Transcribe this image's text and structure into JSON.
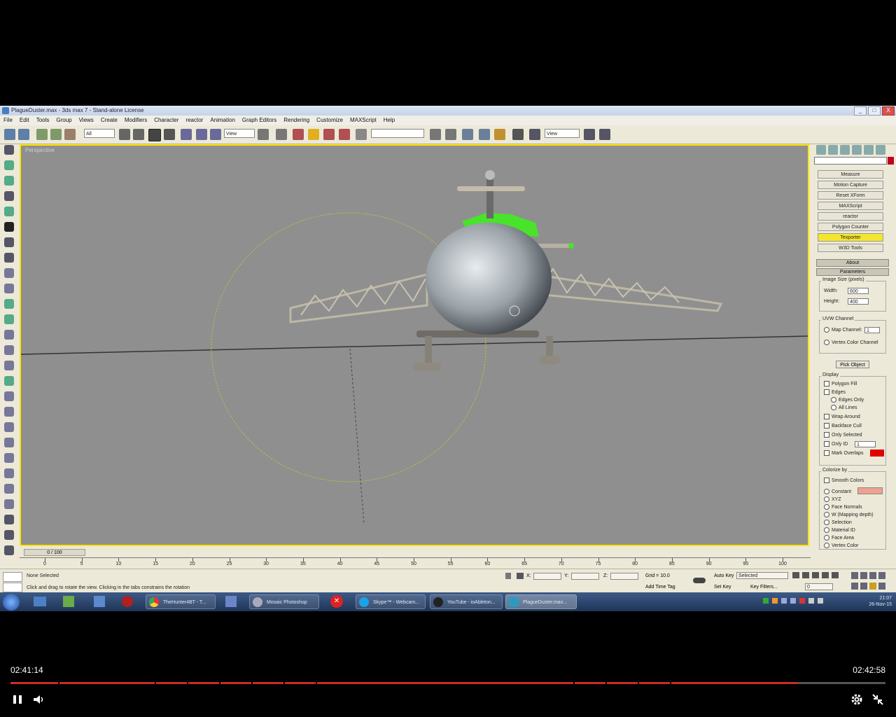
{
  "window": {
    "title": "PlagueDuster.max - 3ds max 7 - Stand-alone License",
    "buttons": [
      "_",
      "□",
      "X"
    ]
  },
  "menubar": [
    "File",
    "Edit",
    "Tools",
    "Group",
    "Views",
    "Create",
    "Modifiers",
    "Character",
    "reactor",
    "Animation",
    "Graph Editors",
    "Rendering",
    "Customize",
    "MAXScript",
    "Help"
  ],
  "toolbar": {
    "filter_select": "All",
    "refcoord_select": "View",
    "namedsel_select": "",
    "render_select": "View"
  },
  "viewport": {
    "label": "Perspective",
    "background": "#8f8f8f",
    "border_color": "#ffe500"
  },
  "command_panel": {
    "utilities": [
      "Measure",
      "Motion Capture",
      "Reset XForm",
      "MAXScript",
      "reactor",
      "Polygon Counter",
      "Texporter",
      "W3D Tools"
    ],
    "active_utility": "Texporter",
    "rollouts": {
      "about": "About",
      "parameters": "Parameters"
    },
    "image_size": {
      "heading": "Image Size (pixels)",
      "width_label": "Width:",
      "width_value": "600",
      "height_label": "Height:",
      "height_value": "400"
    },
    "uvw": {
      "heading": "UVW Channel",
      "map_channel_label": "Map Channel:",
      "map_channel_value": "1",
      "vertex_color": "Vertex Color Channel"
    },
    "pick_object": "Pick Object",
    "display": {
      "heading": "Display",
      "polygon_fill": "Polygon Fill",
      "edges": "Edges",
      "edges_only": "Edges Only",
      "all_lines": "All Lines",
      "wrap_around": "Wrap Around",
      "backface_cull": "Backface Cull",
      "only_selected": "Only Selected",
      "only_id": "Only ID",
      "only_id_value": "1",
      "mark_overlaps": "Mark Overlaps"
    },
    "colorize": {
      "heading": "Colorize by",
      "smooth_colors": "Smooth Colors",
      "constant": "Constant",
      "xyz": "XYZ",
      "face_normals": "Face Normals",
      "w_mapping": "W (Mapping depth)",
      "selection": "Selection",
      "material_id": "Material ID",
      "face_area": "Face Area",
      "vertex_color": "Vertex Color"
    },
    "colors": {
      "mark_overlaps": "#e00000",
      "constant": "#f0a090"
    }
  },
  "timeline": {
    "slider_label": "0 / 100",
    "ticks": [
      "0",
      "5",
      "10",
      "15",
      "20",
      "25",
      "30",
      "35",
      "40",
      "45",
      "50",
      "55",
      "60",
      "65",
      "70",
      "75",
      "80",
      "85",
      "90",
      "95",
      "100"
    ]
  },
  "status": {
    "selection": "None Selected",
    "prompt": "Click and drag to rotate the view.  Clicking in the tabs constrains the rotation",
    "x": "X:",
    "y": "Y:",
    "z": "Z:",
    "grid": "Grid = 10.0",
    "add_time_tag": "Add Time Tag",
    "auto_key": "Auto Key",
    "set_key": "Set Key",
    "selected": "Selected",
    "key_filters": "Key Filters...",
    "frame": "0"
  },
  "taskbar": {
    "tasks": [
      "TheHunter4BT - T...",
      "Mosaic Photoshop",
      "Skype™ - Webcam...",
      "YouTube - ioAbleton...",
      "PlagueDuster.max..."
    ],
    "clock": "21:07",
    "date": "26-Nov-15"
  },
  "player": {
    "current_time": "02:41:14",
    "duration": "02:42:58",
    "progress": 0.9,
    "progress_color": "#cc2b2b"
  }
}
